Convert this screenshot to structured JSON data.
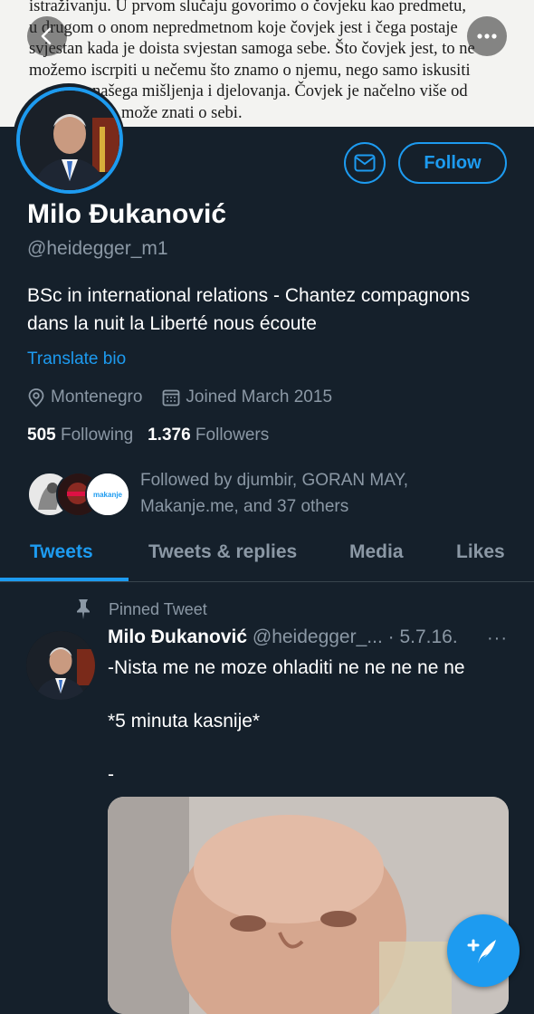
{
  "banner": {
    "lines": [
      "istraživanju. U prvom slučaju govorimo o čovjeku kao predmetu,",
      "u drugom o onom nepredmetnom koje čovjek jest i čega postaje",
      "svjestan kada je doista svjestan samoga sebe. Što čovjek jest, to ne",
      "možemo iscrpiti u nečemu što znamo o njemu, nego samo iskusiti",
      "našega mišljenja i djelovanja. Čovjek je načelno više od",
      "može znati o sebi."
    ]
  },
  "icons": {
    "back": "back-arrow-icon",
    "more": "more-horizontal-icon",
    "message": "mail-icon",
    "location": "location-pin-icon",
    "calendar": "calendar-icon",
    "pin": "pin-icon",
    "compose": "compose-tweet-icon"
  },
  "profile": {
    "follow_label": "Follow",
    "name": "Milo Đukanović",
    "handle": "@heidegger_m1",
    "bio": "BSc in international relations - Chantez compagnons dans la nuit la Liberté nous écoute",
    "translate_label": "Translate bio",
    "location": "Montenegro",
    "joined": "Joined March 2015",
    "following_count": "505",
    "following_label": "Following",
    "followers_count": "1.376",
    "followers_label": "Followers",
    "followed_by": "Followed by djumbir, GORAN MAY, Makanje.me, and 37 others",
    "follower_avatar_text": "makanje"
  },
  "tabs": [
    {
      "label": "Tweets",
      "active": true
    },
    {
      "label": "Tweets & replies",
      "active": false
    },
    {
      "label": "Media",
      "active": false
    },
    {
      "label": "Likes",
      "active": false
    }
  ],
  "tweet": {
    "pinned_label": "Pinned Tweet",
    "author_name": "Milo Đukanović",
    "author_handle": "@heidegger_...",
    "date": "· 5.7.16.",
    "more": "···",
    "lines": [
      "-Nista me ne moze ohladiti ne ne ne ne ne",
      "*5 minuta kasnije*",
      "-"
    ]
  },
  "colors": {
    "background": "#15202b",
    "accent": "#1d9bf0",
    "secondary_text": "#8b98a5",
    "divider": "#38444d"
  }
}
